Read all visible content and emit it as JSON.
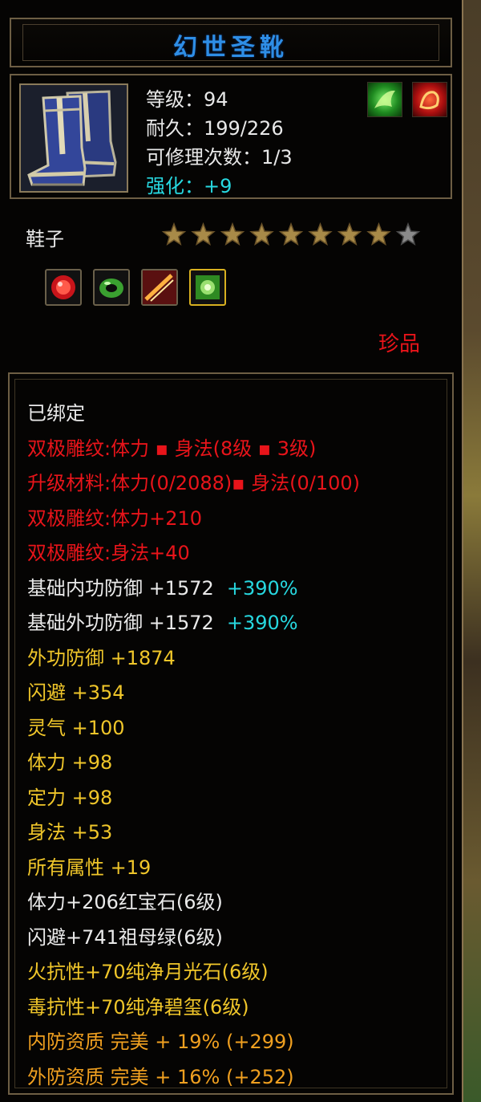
{
  "item": {
    "title": "幻世圣靴",
    "level_text": "等级：94",
    "durability_text": "耐久：199/226",
    "repair_text": "可修理次数：1/3",
    "enhance_text": "强化：+9",
    "type_label": "鞋子",
    "rarity": "珍品",
    "stars_filled": 8,
    "stars_total": 9
  },
  "colors": {
    "title": "#2e8ee6",
    "red": "#e8141a",
    "gold": "#f0c62a",
    "orange": "#f0a020",
    "cyan": "#27d8e0",
    "white": "#eaeaea"
  },
  "icons": [
    "boots-icon",
    "green-rune-icon",
    "red-fire-icon",
    "red-gem-icon",
    "green-jade-icon",
    "fire-slash-icon",
    "green-crystal-icon"
  ],
  "attributes": [
    {
      "text": "已绑定",
      "color": "white"
    },
    {
      "text": "双极雕纹:体力 ▪ 身法(8级 ▪ 3级)",
      "color": "red"
    },
    {
      "text": "升级材料:体力(0/2088)▪ 身法(0/100)",
      "color": "red"
    },
    {
      "text": "双极雕纹:体力+210",
      "color": "red"
    },
    {
      "text": "双极雕纹:身法+40",
      "color": "red"
    },
    {
      "text": "基础内功防御 +1572",
      "extra": "+390%",
      "color": "white"
    },
    {
      "text": "基础外功防御 +1572",
      "extra": "+390%",
      "color": "white"
    },
    {
      "text": "外功防御 +1874",
      "color": "gold"
    },
    {
      "text": "闪避 +354",
      "color": "gold"
    },
    {
      "text": "灵气 +100",
      "color": "gold"
    },
    {
      "text": "体力 +98",
      "color": "gold"
    },
    {
      "text": "定力 +98",
      "color": "gold"
    },
    {
      "text": "身法 +53",
      "color": "gold"
    },
    {
      "text": "所有属性 +19",
      "color": "gold"
    },
    {
      "text": "体力+206红宝石(6级)",
      "color": "white"
    },
    {
      "text": "闪避+741祖母绿(6级)",
      "color": "white"
    },
    {
      "text": "火抗性+70纯净月光石(6级)",
      "color": "gold"
    },
    {
      "text": "毒抗性+70纯净碧玺(6级)",
      "color": "gold"
    },
    {
      "text": "内防资质 完美 + 19% (+299)",
      "color": "orange"
    },
    {
      "text": "外防资质 完美 + 16% (+252)",
      "color": "orange"
    }
  ]
}
